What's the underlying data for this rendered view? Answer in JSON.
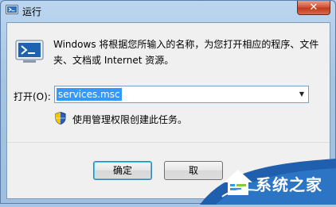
{
  "window": {
    "title": "运行",
    "close_glyph": "✕",
    "title_icon": "run-icon",
    "colors": {
      "selection": "#3399ff",
      "close": "#c23a1c"
    }
  },
  "content": {
    "description": "Windows 将根据您所输入的名称，为您打开相应的程序、文件夹、文档或 Internet 资源。",
    "open_label": "打开(O):",
    "open_value": "services.msc",
    "admin_note": "使用管理权限创建此任务。"
  },
  "buttons": {
    "ok": "确定",
    "cancel": "取"
  },
  "watermark": {
    "text": "系统之家"
  }
}
